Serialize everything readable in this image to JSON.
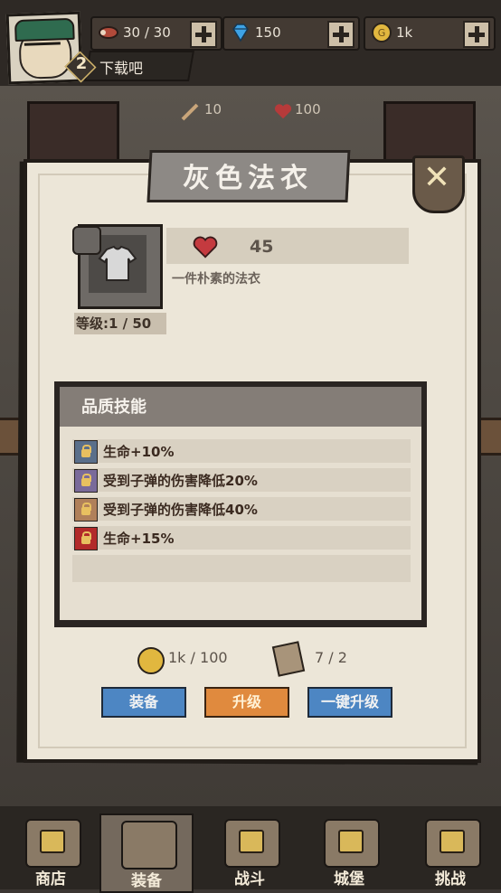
{
  "player": {
    "level": "2",
    "name": "下载吧"
  },
  "resources": {
    "stamina": "30 / 30",
    "gems": "150",
    "coins": "1k"
  },
  "background_stats": {
    "attack": "10",
    "health": "100"
  },
  "dialog": {
    "title": "灰色法衣",
    "item_hp": "45",
    "item_desc": "一件朴素的法衣",
    "item_level": "等级:1 / 50",
    "skills_title": "品质技能",
    "skills": [
      {
        "text": "生命+10%",
        "color": "#5a6f8a"
      },
      {
        "text": "受到子弹的伤害降低20%",
        "color": "#7a6a9a"
      },
      {
        "text": "受到子弹的伤害降低40%",
        "color": "#b0805a"
      },
      {
        "text": "生命+15%",
        "color": "#b22a2a"
      }
    ],
    "cost_coins": "1k / 100",
    "cost_scrolls": "7 / 2",
    "buttons": {
      "equip": "装备",
      "upgrade": "升级",
      "upgrade_all": "一键升级"
    }
  },
  "nav": [
    {
      "label": "商店"
    },
    {
      "label": "装备"
    },
    {
      "label": "战斗"
    },
    {
      "label": "城堡"
    },
    {
      "label": "挑战"
    }
  ]
}
